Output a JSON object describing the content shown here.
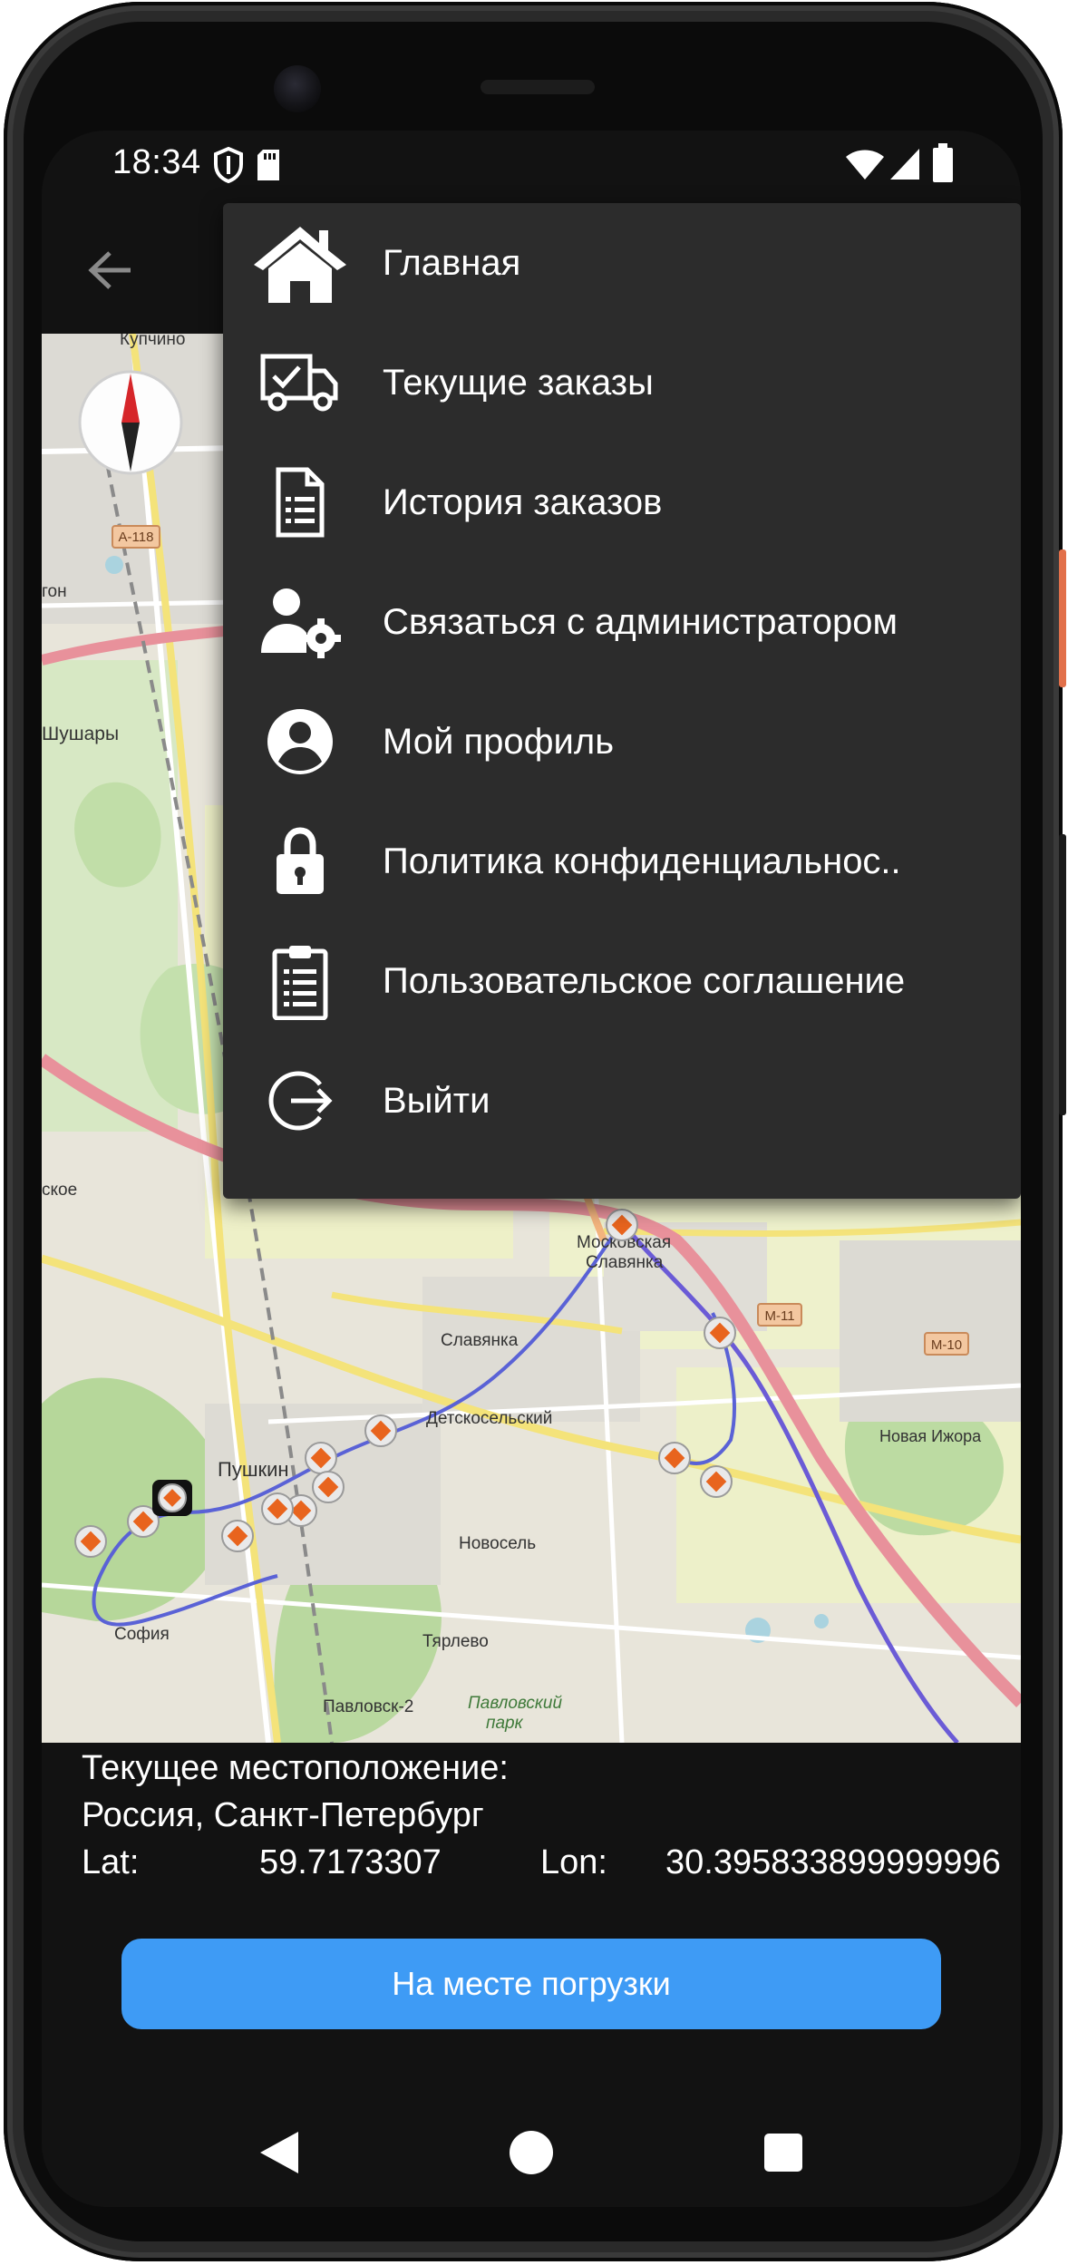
{
  "status_bar": {
    "time": "18:34",
    "icons": [
      "shield-icon",
      "sd-card-icon",
      "wifi-icon",
      "signal-icon",
      "battery-icon"
    ]
  },
  "app_bar": {
    "back_icon": "arrow-left-icon"
  },
  "menu": {
    "items": [
      {
        "label": "Главная",
        "icon": "home-icon"
      },
      {
        "label": "Текущие заказы",
        "icon": "truck-check-icon"
      },
      {
        "label": "История заказов",
        "icon": "document-list-icon"
      },
      {
        "label": "Связаться с администратором",
        "icon": "user-gear-icon"
      },
      {
        "label": "Мой профиль",
        "icon": "account-circle-icon"
      },
      {
        "label": "Политика конфиденциальнос..",
        "icon": "lock-icon"
      },
      {
        "label": "Пользовательское соглашение",
        "icon": "clipboard-list-icon"
      },
      {
        "label": "Выйти",
        "icon": "logout-icon"
      }
    ]
  },
  "map": {
    "labels": {
      "kupchino": "Купчино",
      "a118": "А-118",
      "shushary": "Шушары",
      "moskovskaya_1": "Московская",
      "moskovskaya_2": "Славянка",
      "slavyanka": "Славянка",
      "detskoselsky": "Детскосельский",
      "novaya_izhora": "Новая Ижора",
      "pushkin": "Пушкин",
      "m11": "М-11",
      "m10": "М-10",
      "novoe": "Новосель",
      "sofia": "София",
      "tyarlevo": "Тярлево",
      "pavlovsk2": "Павловск-2",
      "pavlovsky_1": "Павловский",
      "pavlovsky_2": "парк",
      "skoe": "ское",
      "gon": "гон"
    },
    "compass_icon": "compass-icon",
    "marker_icon": "orange-diamond-marker-icon",
    "vehicle_icon": "vehicle-marker-icon"
  },
  "location": {
    "heading": "Текущее местоположение:",
    "address": "Россия, Санкт-Петербург",
    "lat_label": "Lat:",
    "lat_value": "59.7173307",
    "lon_label": "Lon:",
    "lon_value": "30.395833899999996"
  },
  "action_button": {
    "label": "На месте погрузки"
  },
  "nav_bar": {
    "icons": [
      "back-triangle-icon",
      "home-circle-icon",
      "recents-square-icon"
    ]
  },
  "colors": {
    "accent": "#3e9bf5",
    "menu_bg": "#2c2c2c",
    "screen_bg": "#121212",
    "route": "#6b5bd6",
    "marker": "#e8641e"
  }
}
